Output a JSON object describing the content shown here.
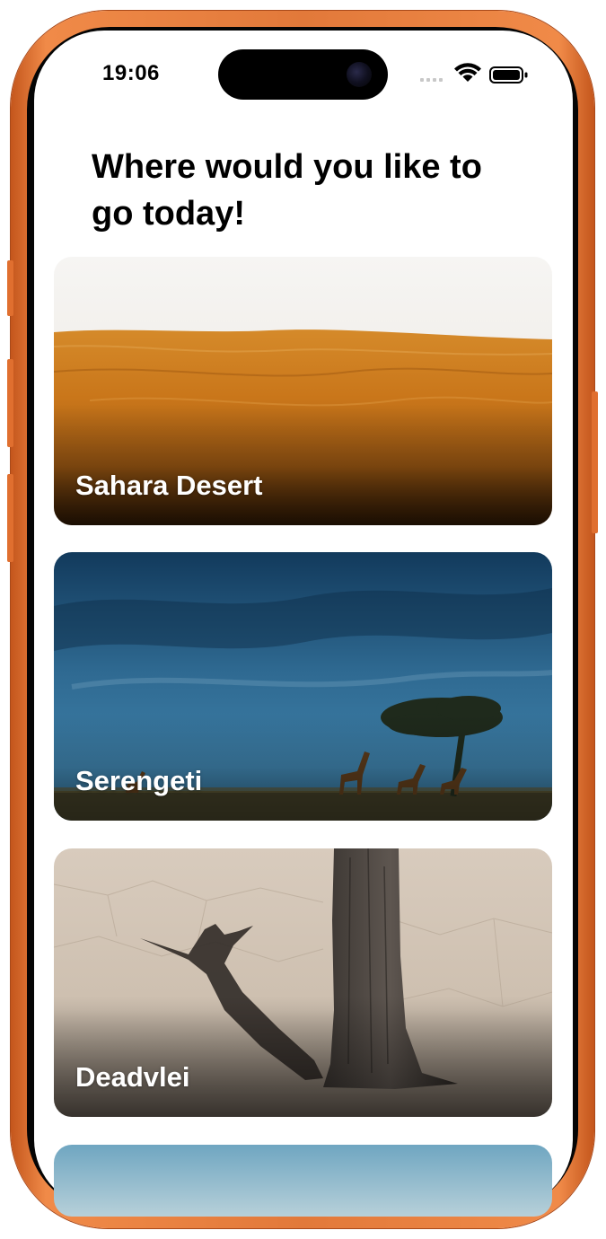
{
  "status_bar": {
    "time": "19:06",
    "icons": [
      "signal-icon",
      "wifi-icon",
      "battery-icon"
    ]
  },
  "header": {
    "title": "Where would you like to go today!"
  },
  "destinations": [
    {
      "label": "Sahara Desert"
    },
    {
      "label": "Serengeti"
    },
    {
      "label": "Deadvlei"
    }
  ],
  "colors": {
    "device_frame": "#e2793a",
    "screen_background": "#ffffff",
    "card_label": "#ffffff"
  }
}
